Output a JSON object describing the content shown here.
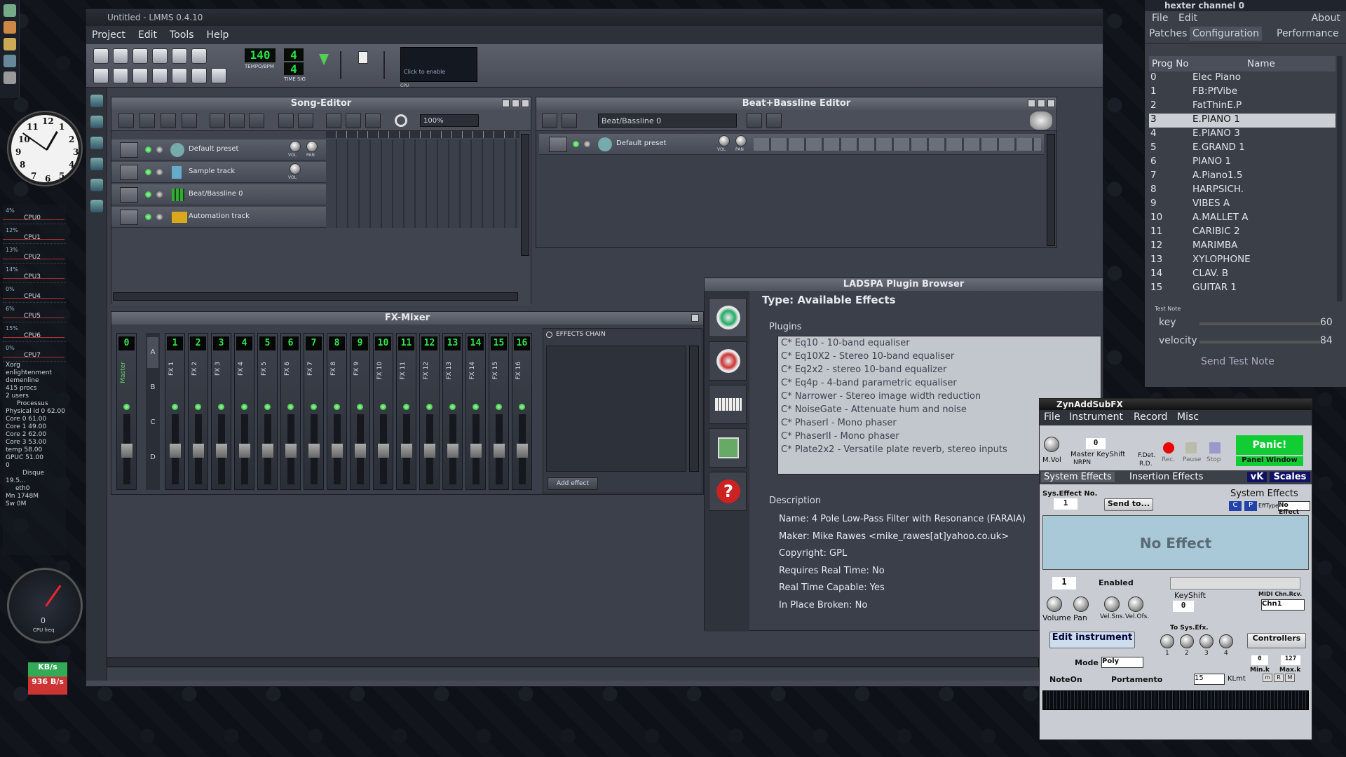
{
  "desktop": {
    "cpus": [
      "CPU0",
      "CPU1",
      "CPU2",
      "CPU3",
      "CPU4",
      "CPU5",
      "CPU6",
      "CPU7"
    ],
    "cpu_pcts": [
      "4%",
      "12%",
      "13%",
      "14%",
      "0%",
      "6%",
      "15%",
      "0%"
    ],
    "procs": [
      "Xorg",
      "enlightenment",
      "demenline"
    ],
    "proc_count": "415 procs",
    "users": "2 users",
    "processus_label": "Processus",
    "sensors": [
      [
        "Physical id 0",
        "62.00"
      ],
      [
        "Core 0",
        "61.00"
      ],
      [
        "Core 1",
        "49.00"
      ],
      [
        "Core 2",
        "62.00"
      ],
      [
        "Core 3",
        "53.00"
      ],
      [
        "temp",
        "58.00"
      ],
      [
        "GPUC",
        "51.00"
      ]
    ],
    "zero": "0",
    "disk_label": "Disque",
    "disk_size": "19.5...",
    "net_iface": "eth0",
    "mem": "Mn 1748M",
    "swap": "Sw 0M",
    "gauge_value": "0",
    "gauge_label": "CPU freq",
    "net_down": "KB/s",
    "net_up": "936 B/s",
    "clock_numbers": [
      "12",
      "1",
      "2",
      "3",
      "4",
      "5",
      "6",
      "7",
      "8",
      "9",
      "10",
      "11"
    ]
  },
  "lmms": {
    "title": "Untitled - LMMS 0.4.10",
    "menu": [
      "Project",
      "Edit",
      "Tools",
      "Help"
    ],
    "tempo": "140",
    "tempo_label": "TEMPO/BPM",
    "timesig_top": "4",
    "timesig_bottom": "4",
    "timesig_label": "TIME SIG",
    "cpu_hint": "Click to enable",
    "cpu_label": "CPU"
  },
  "song_editor": {
    "title": "Song-Editor",
    "zoom": "100%",
    "tracks": [
      "Default preset",
      "Sample track",
      "Beat/Bassline 0",
      "Automation track"
    ],
    "vol": "VOL",
    "pan": "PAN"
  },
  "bb_editor": {
    "title": "Beat+Bassline Editor",
    "selector": "Beat/Bassline 0",
    "track": "Default preset",
    "vol": "VOL",
    "pan": "PAN"
  },
  "fx_mixer": {
    "title": "FX-Mixer",
    "master_num": "0",
    "master_label": "Master",
    "channels": [
      {
        "num": "1",
        "label": "FX 1"
      },
      {
        "num": "2",
        "label": "FX 2"
      },
      {
        "num": "3",
        "label": "FX 3"
      },
      {
        "num": "4",
        "label": "FX 4"
      },
      {
        "num": "5",
        "label": "FX 5"
      },
      {
        "num": "6",
        "label": "FX 6"
      },
      {
        "num": "7",
        "label": "FX 7"
      },
      {
        "num": "8",
        "label": "FX 8"
      },
      {
        "num": "9",
        "label": "FX 9"
      },
      {
        "num": "10",
        "label": "FX 10"
      },
      {
        "num": "11",
        "label": "FX 11"
      },
      {
        "num": "12",
        "label": "FX 12"
      },
      {
        "num": "13",
        "label": "FX 13"
      },
      {
        "num": "14",
        "label": "FX 14"
      },
      {
        "num": "15",
        "label": "FX 15"
      },
      {
        "num": "16",
        "label": "FX 16"
      }
    ],
    "banks": [
      "A",
      "B",
      "C",
      "D"
    ],
    "effects_chain": "EFFECTS CHAIN",
    "add_effect": "Add effect"
  },
  "ladspa": {
    "title": "LADSPA Plugin Browser",
    "type": "Type: Available Effects",
    "plugins_label": "Plugins",
    "plugins": [
      "C* Eq10 - 10-band equaliser",
      "C* Eq10X2 - Stereo 10-band equaliser",
      "C* Eq2x2 - stereo 10-band equalizer",
      "C* Eq4p - 4-band parametric equaliser",
      "C* Narrower - Stereo image width reduction",
      "C* NoiseGate - Attenuate hum and noise",
      "C* PhaserI - Mono phaser",
      "C* PhaserII - Mono phaser",
      "C* Plate2x2 - Versatile plate reverb, stereo inputs"
    ],
    "description_label": "Description",
    "description": [
      "Name: 4 Pole Low-Pass Filter with Resonance (FARAIA)",
      "Maker: Mike Rawes <mike_rawes[at]yahoo.co.uk>",
      "Copyright: GPL",
      "Requires Real Time: No",
      "Real Time Capable: Yes",
      "In Place Broken: No"
    ]
  },
  "hexter": {
    "title": "hexter channel 0",
    "menu": [
      "File",
      "Edit"
    ],
    "about": "About",
    "tabs": [
      "Patches",
      "Configuration",
      "Performance"
    ],
    "col_prog": "Prog No",
    "col_name": "Name",
    "patches": [
      [
        "0",
        "Elec Piano"
      ],
      [
        "1",
        "FB:PfVibe"
      ],
      [
        "2",
        "FatThinE.P"
      ],
      [
        "3",
        "E.PIANO 1"
      ],
      [
        "4",
        "E.PIANO 3"
      ],
      [
        "5",
        "E.GRAND 1"
      ],
      [
        "6",
        "PIANO   1"
      ],
      [
        "7",
        "A.Piano1.5"
      ],
      [
        "8",
        "HARPSICH."
      ],
      [
        "9",
        "VIBES    A"
      ],
      [
        "10",
        "A.MALLET A"
      ],
      [
        "11",
        "CARIBIC 2"
      ],
      [
        "12",
        "MARIMBA"
      ],
      [
        "13",
        "XYLOPHONE"
      ],
      [
        "14",
        "CLAV.    B"
      ],
      [
        "15",
        "GUITAR   1"
      ]
    ],
    "selected_index": 3,
    "test_note": "Test Note",
    "key_label": "key",
    "key_value": "60",
    "velocity_label": "velocity",
    "velocity_value": "84",
    "send_test_note": "Send Test Note"
  },
  "zyn": {
    "title": "ZynAddSubFX",
    "menu": [
      "File",
      "Instrument",
      "Record",
      "Misc"
    ],
    "mvol": "M.Vol",
    "master_keyshift": "Master KeyShift",
    "keyshift_value": "0",
    "nrpn": "NRPN",
    "fdet": "F.Det.",
    "rd": "R.D.",
    "rec": "Rec.",
    "pause": "Pause",
    "stop": "Stop",
    "panic": "Panic!",
    "panel_window": "Panel Window",
    "vk": "vK",
    "scales": "Scales",
    "tabs": [
      "System Effects",
      "Insertion Effects"
    ],
    "sys_effect_no_label": "Sys.Effect No.",
    "sys_effect_no": "1",
    "send_to": "Send to...",
    "c": "C",
    "p": "P",
    "system_effects": "System Effects",
    "efftype_label": "EffType",
    "efftype": "No Effect",
    "no_effect": "No Effect",
    "part_no": "1",
    "enabled": "Enabled",
    "keyshift_label": "KeyShift",
    "part_keyshift": "0",
    "midi_chn_label": "MIDI Chn.Rcv.",
    "midi_chn": "Chn1",
    "volume": "Volume",
    "pan": "Pan",
    "velsns": "Vel.Sns.",
    "velofs": "Vel.Ofs.",
    "to_sys_efx": "To Sys.Efx.",
    "sys_efx_nums": [
      "1",
      "2",
      "3",
      "4"
    ],
    "edit_instrument": "Edit instrument",
    "controllers": "Controllers",
    "mode_label": "Mode :",
    "mode": "Poly",
    "min_k": "Min.k",
    "max_k": "Max.k",
    "min_k_val": "0",
    "max_k_val": "127",
    "noteon": "NoteOn",
    "portamento": "Portamento",
    "klmt_val": "15",
    "klmt": "KLmt",
    "mrm": [
      "m",
      "R",
      "M"
    ]
  }
}
